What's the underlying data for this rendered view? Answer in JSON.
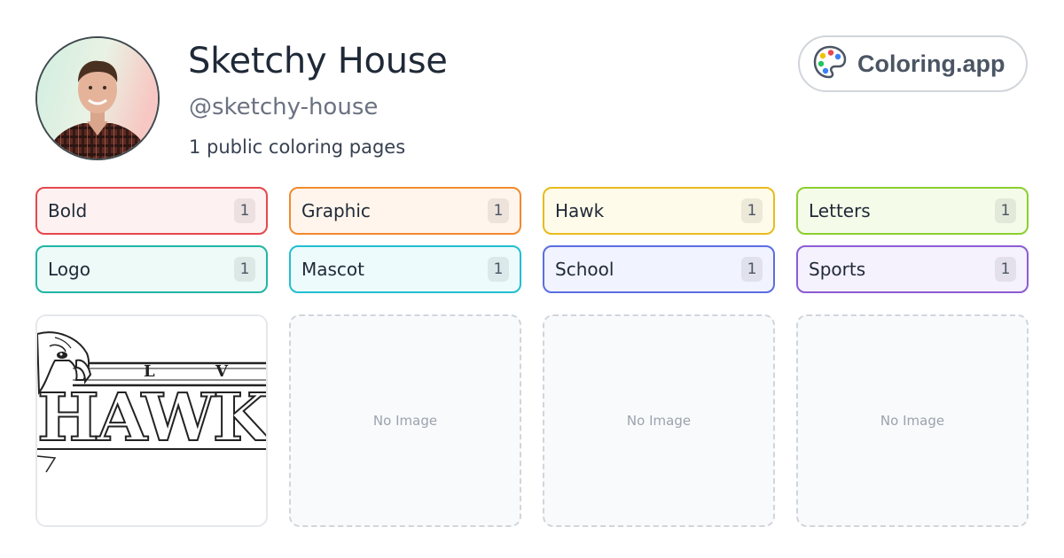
{
  "profile": {
    "name": "Sketchy House",
    "handle": "@sketchy-house",
    "count_text": "1 public coloring pages"
  },
  "brand": {
    "label": "Coloring.app",
    "icon": "palette-icon"
  },
  "tags": [
    {
      "label": "Bold",
      "count": "1",
      "border": "#e5484d",
      "bg": "#fef1f1"
    },
    {
      "label": "Graphic",
      "count": "1",
      "border": "#f28a2e",
      "bg": "#fff5ec"
    },
    {
      "label": "Hawk",
      "count": "1",
      "border": "#e9bb1d",
      "bg": "#fefbea"
    },
    {
      "label": "Letters",
      "count": "1",
      "border": "#8ccf2e",
      "bg": "#f4fbe9"
    },
    {
      "label": "Logo",
      "count": "1",
      "border": "#21b5a6",
      "bg": "#edfaf8"
    },
    {
      "label": "Mascot",
      "count": "1",
      "border": "#22bfd0",
      "bg": "#edfbfd"
    },
    {
      "label": "School",
      "count": "1",
      "border": "#5b6ee1",
      "bg": "#f1f3fe"
    },
    {
      "label": "Sports",
      "count": "1",
      "border": "#8b5cd6",
      "bg": "#f5f1fd"
    }
  ],
  "cards": [
    {
      "type": "image",
      "image_text_small": [
        "L",
        "V"
      ],
      "image_text_big": "HAWKS"
    },
    {
      "type": "empty",
      "label": "No Image"
    },
    {
      "type": "empty",
      "label": "No Image"
    },
    {
      "type": "empty",
      "label": "No Image"
    }
  ]
}
